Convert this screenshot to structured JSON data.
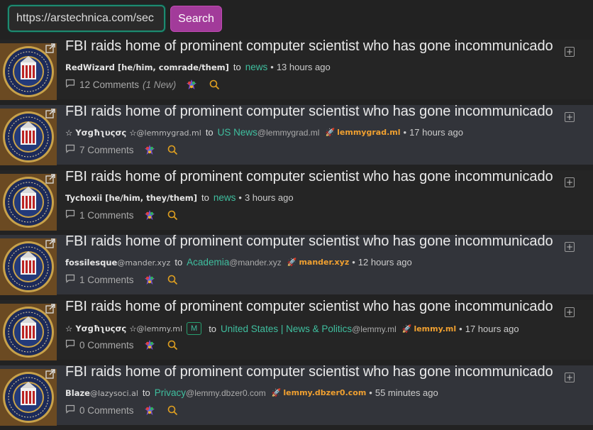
{
  "search": {
    "value": "https://arstechnica.com/sec",
    "button_label": "Search"
  },
  "posts": [
    {
      "title": "FBI raids home of prominent computer scientist who has gone incommunicado",
      "author_name": "RedWizard [he/him, comrade/them]",
      "author_instance": "",
      "to": "to",
      "community_name": "news",
      "community_instance": "",
      "badge": "",
      "instance": "",
      "time": "13 hours ago",
      "comments": "12 Comments",
      "new_comments": "(1 New)"
    },
    {
      "title": "FBI raids home of prominent computer scientist who has gone incommunicado",
      "author_name": "☆ Υσɡħʅυςσς ☆",
      "author_instance": "@lemmygrad.ml",
      "to": "to",
      "community_name": "US News",
      "community_instance": "@lemmygrad.ml",
      "badge": "",
      "instance": "lemmygrad.ml",
      "time": "17 hours ago",
      "comments": "7 Comments",
      "new_comments": ""
    },
    {
      "title": "FBI raids home of prominent computer scientist who has gone incommunicado",
      "author_name": "Tychoxii [he/him, they/them]",
      "author_instance": "",
      "to": "to",
      "community_name": "news",
      "community_instance": "",
      "badge": "",
      "instance": "",
      "time": "3 hours ago",
      "comments": "1 Comments",
      "new_comments": ""
    },
    {
      "title": "FBI raids home of prominent computer scientist who has gone incommunicado",
      "author_name": "fossilesque",
      "author_instance": "@mander.xyz",
      "to": "to",
      "community_name": "Academia",
      "community_instance": "@mander.xyz",
      "badge": "",
      "instance": "mander.xyz",
      "time": "12 hours ago",
      "comments": "1 Comments",
      "new_comments": ""
    },
    {
      "title": "FBI raids home of prominent computer scientist who has gone incommunicado",
      "author_name": "☆ Υσɡħʅυςσς ☆",
      "author_instance": "@lemmy.ml",
      "to": "to",
      "community_name": "United States | News & Politics",
      "community_instance": "@lemmy.ml",
      "badge": "M",
      "instance": "lemmy.ml",
      "time": "17 hours ago",
      "comments": "0 Comments",
      "new_comments": ""
    },
    {
      "title": "FBI raids home of prominent computer scientist who has gone incommunicado",
      "author_name": "Blaze",
      "author_instance": "@lazysoci.al",
      "to": "to",
      "community_name": "Privacy",
      "community_instance": "@lemmy.dbzer0.com",
      "badge": "",
      "instance": "lemmy.dbzer0.com",
      "time": "55 minutes ago",
      "comments": "0 Comments",
      "new_comments": ""
    }
  ],
  "colors": {
    "accent_green": "#3fbf9f",
    "search_button": "#a23b9a",
    "instance_orange": "#f0a030"
  },
  "icons": {
    "thumbnail": "fbi-seal-thumbnail",
    "external": "external-link-icon",
    "expand": "expand-plus-icon",
    "comment": "comment-icon",
    "crosspost": "crosspost-icon",
    "search": "search-icon"
  }
}
